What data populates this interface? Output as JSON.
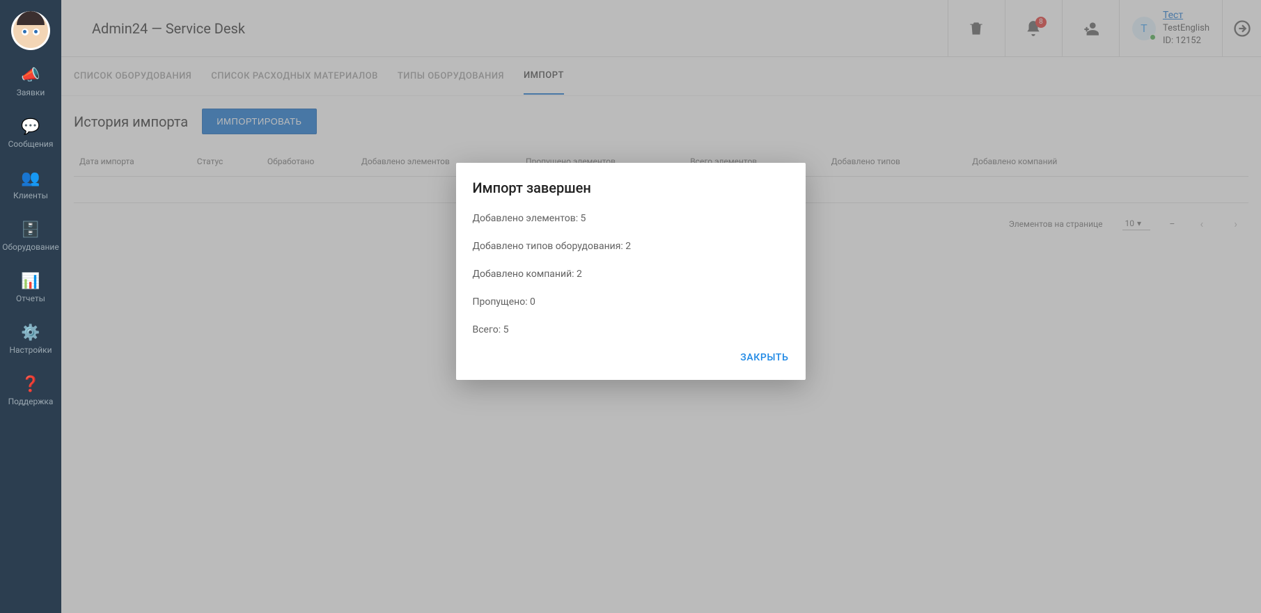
{
  "app_title": "Admin24 — Service Desk",
  "sidebar": {
    "items": [
      {
        "label": "Заявки",
        "icon": "megaphone"
      },
      {
        "label": "Сообщения",
        "icon": "chat"
      },
      {
        "label": "Клиенты",
        "icon": "people"
      },
      {
        "label": "Оборудование",
        "icon": "equipment"
      },
      {
        "label": "Отчеты",
        "icon": "reports"
      },
      {
        "label": "Настройки",
        "icon": "settings"
      },
      {
        "label": "Поддержка",
        "icon": "support"
      }
    ]
  },
  "header": {
    "notifications_count": "8",
    "user_avatar_initial": "T",
    "user_link": "Тест",
    "user_name": "TestEnglish",
    "user_id_label": "ID: 12152"
  },
  "tabs": [
    {
      "label": "СПИСОК ОБОРУДОВАНИЯ",
      "active": false
    },
    {
      "label": "СПИСОК РАСХОДНЫХ МАТЕРИАЛОВ",
      "active": false
    },
    {
      "label": "ТИПЫ ОБОРУДОВАНИЯ",
      "active": false
    },
    {
      "label": "ИМПОРТ",
      "active": true
    }
  ],
  "content": {
    "section_title": "История импорта",
    "import_button": "ИМПОРТИРОВАТЬ",
    "columns": [
      "Дата импорта",
      "Статус",
      "Обработано",
      "Добавлено элементов",
      "Пропущено элементов",
      "Всего элементов",
      "Добавлено типов",
      "Добавлено компаний"
    ],
    "pagination": {
      "items_per_page_label": "Элементов на странице",
      "page_size": "10",
      "range": "–"
    }
  },
  "modal": {
    "title": "Импорт завершен",
    "lines": [
      "Добавлено элементов: 5",
      "Добавлено типов оборудования: 2",
      "Добавлено компаний: 2",
      "Пропущено: 0",
      "Всего: 5"
    ],
    "close_label": "ЗАКРЫТЬ"
  }
}
